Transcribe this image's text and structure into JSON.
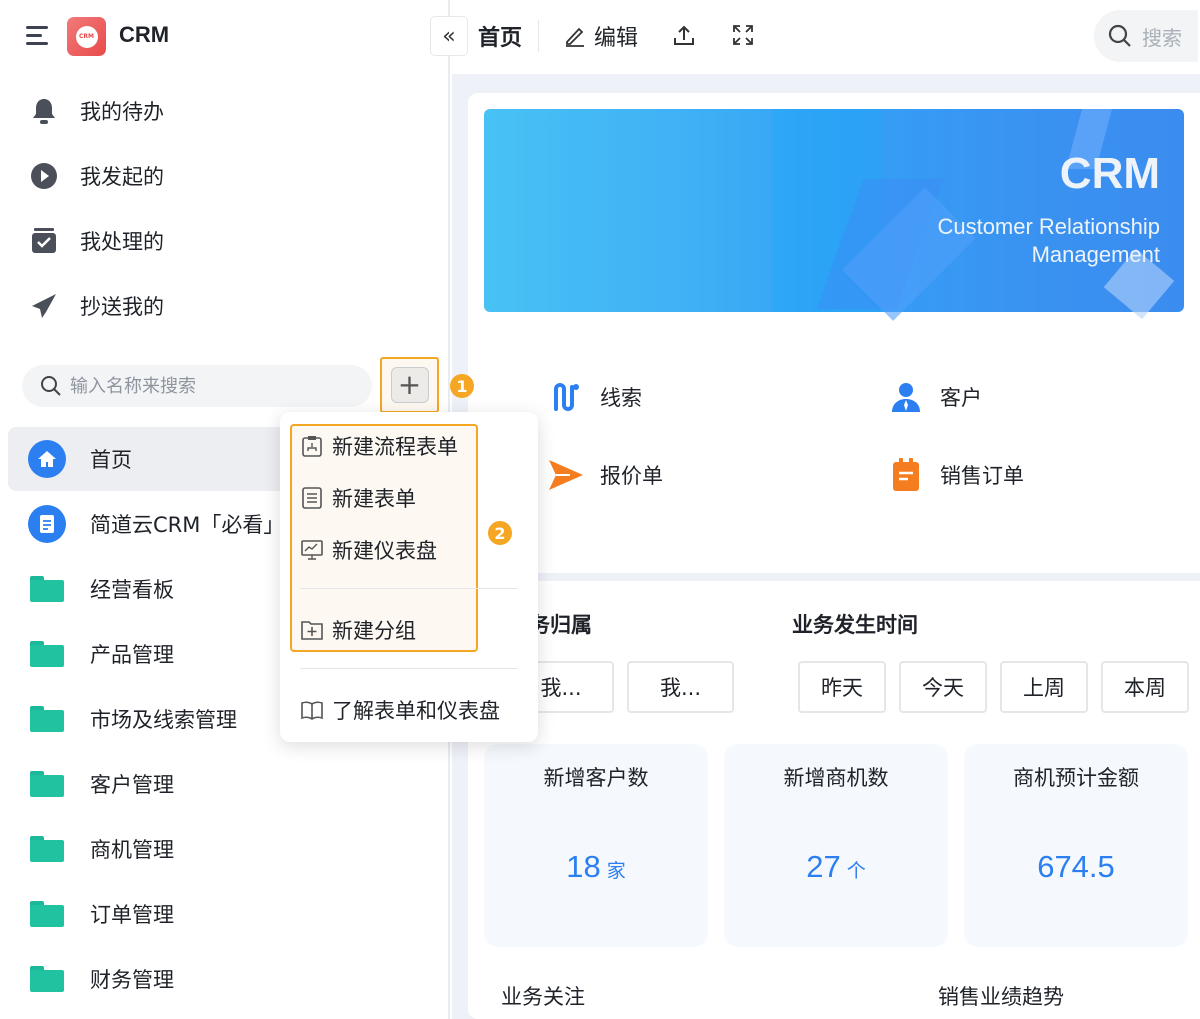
{
  "app": {
    "name": "CRM",
    "logo_text": "CRM"
  },
  "quick_nav": [
    {
      "label": "我的待办",
      "icon": "bell-icon"
    },
    {
      "label": "我发起的",
      "icon": "play-circle-icon"
    },
    {
      "label": "我处理的",
      "icon": "checked-box-icon"
    },
    {
      "label": "抄送我的",
      "icon": "paper-plane-icon"
    }
  ],
  "sidebar_search": {
    "placeholder": "输入名称来搜索"
  },
  "callouts": {
    "one": "1",
    "two": "2"
  },
  "nav": [
    {
      "label": "首页",
      "icon": "home-icon"
    },
    {
      "label": "简道云CRM「必看」",
      "icon": "document-icon"
    },
    {
      "label": "经营看板",
      "icon": "folder-icon"
    },
    {
      "label": "产品管理",
      "icon": "folder-icon"
    },
    {
      "label": "市场及线索管理",
      "icon": "folder-icon"
    },
    {
      "label": "客户管理",
      "icon": "folder-icon"
    },
    {
      "label": "商机管理",
      "icon": "folder-icon"
    },
    {
      "label": "订单管理",
      "icon": "folder-icon"
    },
    {
      "label": "财务管理",
      "icon": "folder-icon"
    }
  ],
  "create_menu": {
    "items": [
      {
        "label": "新建流程表单"
      },
      {
        "label": "新建表单"
      },
      {
        "label": "新建仪表盘"
      },
      {
        "label": "新建分组"
      }
    ],
    "learn": "了解表单和仪表盘"
  },
  "topbar": {
    "title": "首页",
    "edit": "编辑",
    "search_placeholder": "搜索"
  },
  "banner": {
    "title": "CRM",
    "subtitle": "Customer Relationship Management"
  },
  "shortcuts": [
    {
      "label": "线索",
      "color": "#2b7ff0"
    },
    {
      "label": "客户",
      "color": "#2b7ff0"
    },
    {
      "label": "报价单",
      "color": "#f57c1f"
    },
    {
      "label": "销售订单",
      "color": "#f57c1f"
    }
  ],
  "filters": {
    "owner_label": "业务归属",
    "owner_options": [
      "我...",
      "我..."
    ],
    "time_label": "业务发生时间",
    "time_options": [
      "昨天",
      "今天",
      "上周",
      "本周"
    ]
  },
  "stats": [
    {
      "title": "新增客户数",
      "value": "18",
      "unit": "家"
    },
    {
      "title": "新增商机数",
      "value": "27",
      "unit": "个"
    },
    {
      "title": "商机预计金额",
      "value": "674.5",
      "unit": ""
    }
  ],
  "sections": {
    "focus": "业务关注",
    "trend": "销售业绩趋势"
  },
  "colors": {
    "accent": "#2b7ff0",
    "highlight": "#f5a623",
    "folder": "#21c2a0"
  }
}
